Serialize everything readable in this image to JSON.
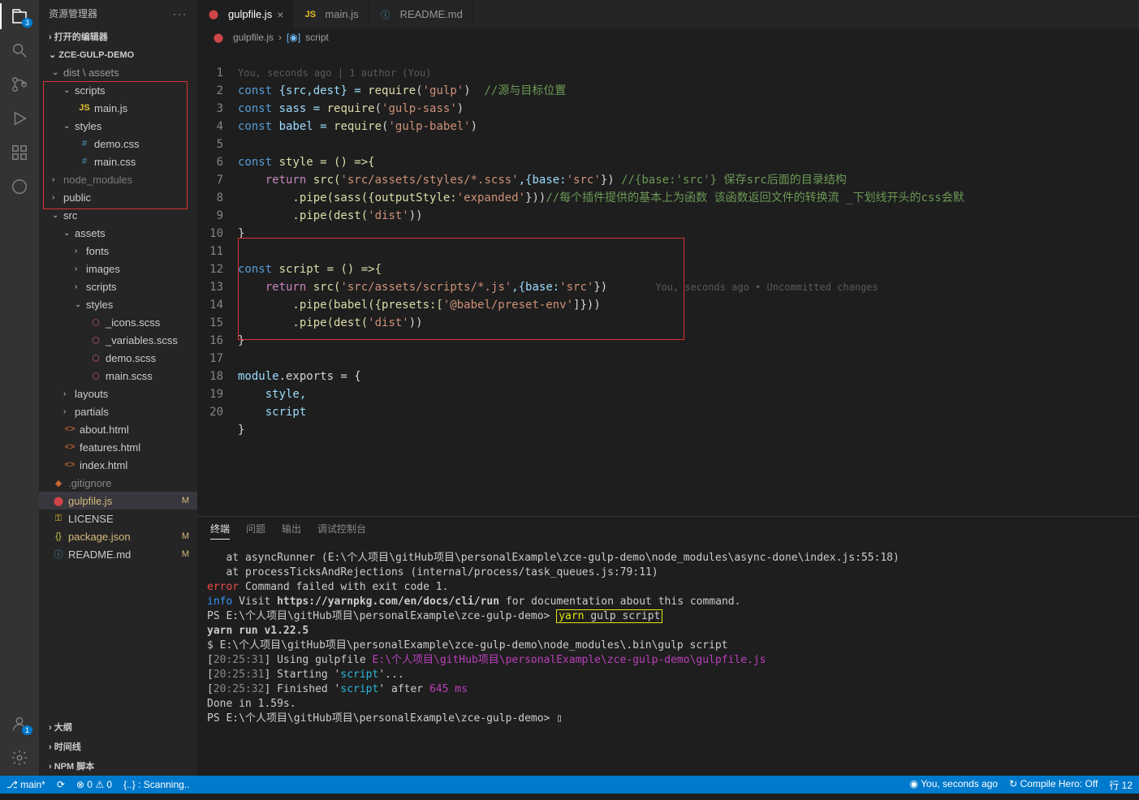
{
  "sidebar": {
    "title": "资源管理器",
    "sections": {
      "openEditors": "打开的编辑器",
      "project": "ZCE-GULP-DEMO",
      "outline": "大纲",
      "timeline": "时间线",
      "npm": "NPM 脚本"
    },
    "tree": {
      "distAssets": "dist \\ assets",
      "scripts": "scripts",
      "mainjs": "main.js",
      "styles": "styles",
      "democss": "demo.css",
      "maincss": "main.css",
      "nodeModules": "node_modules",
      "public": "public",
      "src": "src",
      "assets": "assets",
      "fonts": "fonts",
      "images": "images",
      "scripts2": "scripts",
      "styles2": "styles",
      "iconsscss": "_icons.scss",
      "varscss": "_variables.scss",
      "demoscss": "demo.scss",
      "mainscss": "main.scss",
      "layouts": "layouts",
      "partials": "partials",
      "abouthtml": "about.html",
      "featureshtml": "features.html",
      "indexhtml": "index.html",
      "gitignore": ".gitignore",
      "gulpfile": "gulpfile.js",
      "license": "LICENSE",
      "packagejson": "package.json",
      "readme": "README.md"
    },
    "modM": "M"
  },
  "tabs": {
    "t1": "gulpfile.js",
    "t2": "main.js",
    "t3": "README.md"
  },
  "breadcrumb": {
    "file": "gulpfile.js",
    "symbol": "script"
  },
  "blame": "You, seconds ago | 1 author (You)",
  "inlineBlame": "You, seconds ago • Uncommitted changes",
  "code": {
    "l1_a": "const",
    "l1_b": " {src,dest} = ",
    "l1_c": "require",
    "l1_d": "(",
    "l1_e": "'gulp'",
    "l1_f": ")  ",
    "l1_g": "//源与目标位置",
    "l2_a": "const",
    "l2_b": " sass = ",
    "l2_c": "require",
    "l2_d": "(",
    "l2_e": "'gulp-sass'",
    "l2_f": ")",
    "l3_a": "const",
    "l3_b": " babel = ",
    "l3_c": "require",
    "l3_d": "(",
    "l3_e": "'gulp-babel'",
    "l3_f": ")",
    "l5_a": "const",
    "l5_b": " style = () =>{",
    "l6_a": "    return",
    "l6_b": " src(",
    "l6_c": "'src/assets/styles/*.scss'",
    "l6_d": ",{base:",
    "l6_e": "'src'",
    "l6_f": "}) ",
    "l6_g": "//{base:'src'} 保存src后面的目录结构",
    "l7_a": "        .pipe(sass({outputStyle:",
    "l7_b": "'expanded'",
    "l7_c": "}))",
    "l7_d": "//每个插件提供的基本上为函数 该函数返回文件的转换流 _下划线开头的css会默",
    "l8_a": "        .pipe(dest(",
    "l8_b": "'dist'",
    "l8_c": "))",
    "l9": "}",
    "l11_a": "const",
    "l11_b": " script = () =>{",
    "l12_a": "    return",
    "l12_b": " src(",
    "l12_c": "'src/assets/scripts/*.js'",
    "l12_d": ",{base:",
    "l12_e": "'src'",
    "l12_f": "})",
    "l13_a": "        .pipe(babel({presets:[",
    "l13_b": "'@babel/preset-env'",
    "l13_c": "]}))",
    "l14_a": "        .pipe(dest(",
    "l14_b": "'dist'",
    "l14_c": "))",
    "l15": "}",
    "l17_a": "module",
    "l17_b": ".exports = {",
    "l18": "    style,",
    "l19": "    script",
    "l20": "}"
  },
  "panel": {
    "tabs": {
      "terminal": "终端",
      "problems": "问题",
      "output": "输出",
      "debug": "调试控制台"
    }
  },
  "terminal": {
    "l1": "   at asyncRunner (E:\\个人项目\\gitHub项目\\personalExample\\zce-gulp-demo\\node_modules\\async-done\\index.js:55:18)",
    "l2": "   at processTicksAndRejections (internal/process/task_queues.js:79:11)",
    "l3a": "error",
    "l3b": " Command failed with exit code 1.",
    "l4a": "info",
    "l4b": " Visit ",
    "l4c": "https://yarnpkg.com/en/docs/cli/run",
    "l4d": " for documentation about this command.",
    "l5a": "PS E:\\个人项目\\gitHub项目\\personalExample\\zce-gulp-demo> ",
    "l5b": "yarn",
    "l5c": " gulp script",
    "l6": "yarn run v1.22.5",
    "l7": "$ E:\\个人项目\\gitHub项目\\personalExample\\zce-gulp-demo\\node_modules\\.bin\\gulp script",
    "l8a": "[",
    "l8b": "20:25:31",
    "l8c": "] Using gulpfile ",
    "l8d": "E:\\个人项目\\gitHub项目\\personalExample\\zce-gulp-demo\\gulpfile.js",
    "l9a": "[",
    "l9b": "20:25:31",
    "l9c": "] Starting '",
    "l9d": "script",
    "l9e": "'...",
    "l10a": "[",
    "l10b": "20:25:32",
    "l10c": "] Finished '",
    "l10d": "script",
    "l10e": "' after ",
    "l10f": "645 ms",
    "l11": "Done in 1.59s.",
    "l12": "PS E:\\个人项目\\gitHub项目\\personalExample\\zce-gulp-demo> "
  },
  "status": {
    "branch": "main*",
    "sync": "⟳",
    "errors": "⊗ 0 ⚠ 0",
    "scanning": "{..} : Scanning..",
    "blame": "You, seconds ago",
    "compile": "Compile Hero: Off",
    "line": "行 12"
  },
  "badges": {
    "explorer": "3",
    "scm": "1"
  }
}
